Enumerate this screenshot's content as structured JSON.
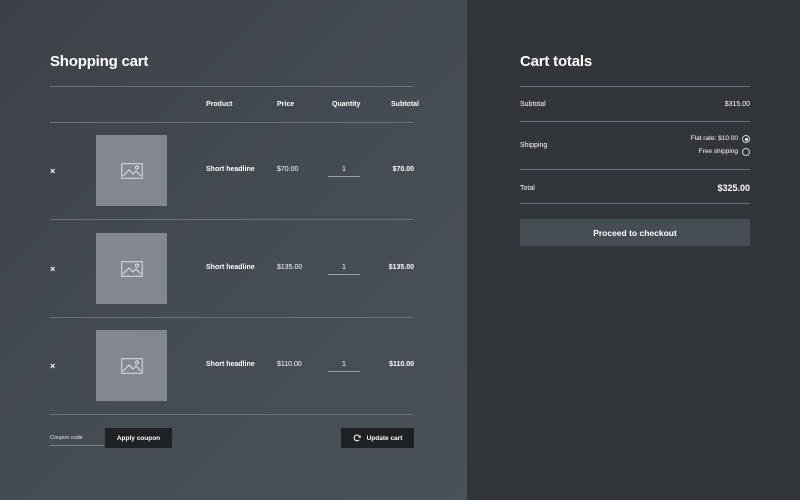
{
  "cart": {
    "title": "Shopping cart",
    "columns": {
      "product": "Product",
      "price": "Price",
      "quantity": "Quantity",
      "subtotal": "Subtotal"
    },
    "remove_symbol": "×",
    "items": [
      {
        "name": "Short headline",
        "price": "$70.00",
        "quantity": "1",
        "subtotal": "$70.00"
      },
      {
        "name": "Short headline",
        "price": "$135.00",
        "quantity": "1",
        "subtotal": "$135.00"
      },
      {
        "name": "Short headline",
        "price": "$110.00",
        "quantity": "1",
        "subtotal": "$110.00"
      }
    ],
    "coupon_placeholder": "Coupon code",
    "apply_coupon_label": "Apply coupon",
    "update_cart_label": "Update cart",
    "image_icon": "image-placeholder-icon",
    "refresh_icon": "refresh-icon"
  },
  "totals": {
    "title": "Cart totals",
    "subtotal_label": "Subtotal",
    "subtotal_value": "$315.00",
    "shipping_label": "Shipping",
    "shipping_options": [
      {
        "label": "Flat rate: $10.00",
        "selected": true
      },
      {
        "label": "Free shipping",
        "selected": false
      }
    ],
    "total_label": "Total",
    "total_value": "$325.00",
    "checkout_label": "Proceed to checkout"
  },
  "colors": {
    "left_panel": "#454b52",
    "right_panel": "#32363a",
    "thumbnail": "#82888d",
    "dark_button": "#1f2225",
    "checkout_button": "#474d54"
  }
}
